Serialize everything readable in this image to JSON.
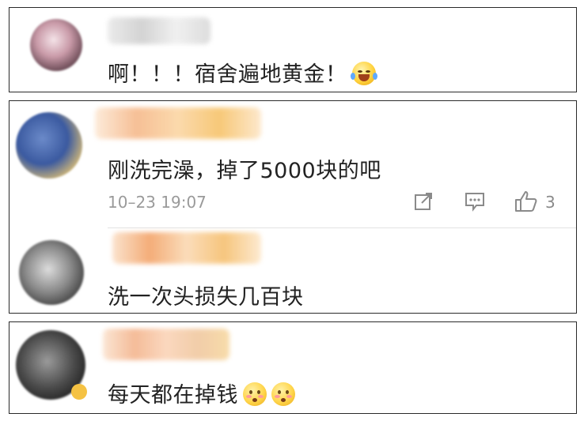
{
  "comments": [
    {
      "text": "啊！！！宿舍遍地黄金！"
    },
    {
      "text": "刚洗完澡，掉了5000块的吧",
      "timestamp": "10–23 19:07",
      "like_count": "3",
      "icons": [
        "share-icon",
        "comment-icon",
        "like-icon"
      ],
      "reply": {
        "text": "洗一次头损失几百块"
      }
    },
    {
      "text": "每天都在掉钱"
    }
  ]
}
